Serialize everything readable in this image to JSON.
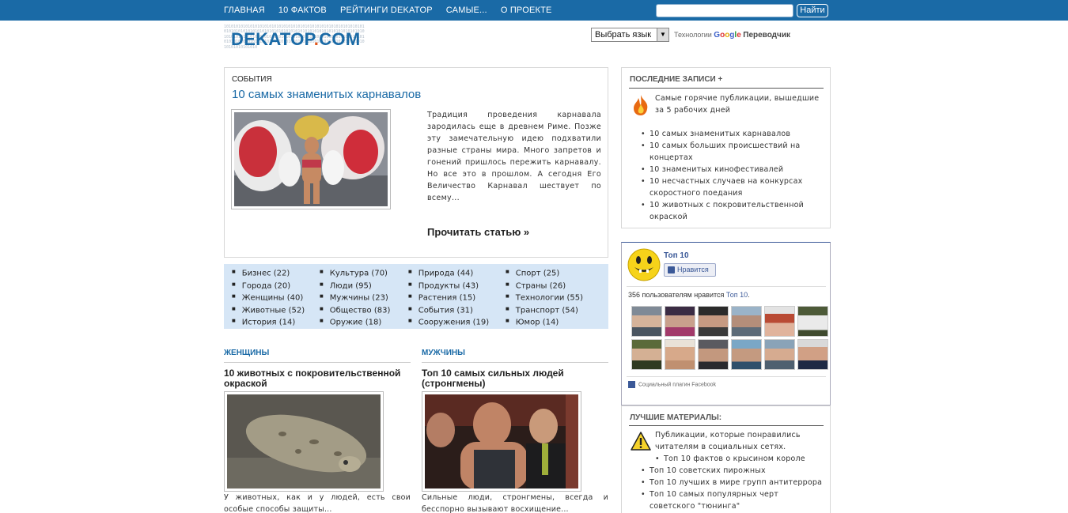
{
  "nav": {
    "items": [
      "ГЛАВНАЯ",
      "10 ФАКТОВ",
      "РЕЙТИНГИ DEKATOP",
      "САМЫЕ...",
      "О ПРОЕКТЕ"
    ],
    "search_placeholder": "",
    "search_button": "Найти"
  },
  "logo": {
    "name": "DEKATOP",
    "dot": ".",
    "tld": "COM",
    "bg_digits": "1010101010101010101010101010101010101010101010101010101010101010101010101010101010101010101010101010101010101010101010101010101010101010101010101010101010101010101010101010101010101010101010101010101010101010101010101010101010101010101010101010101010"
  },
  "translator": {
    "select_label": "Выбрать язык",
    "powered": "Технологии",
    "google": [
      "G",
      "o",
      "o",
      "g",
      "l",
      "e"
    ],
    "product": "Переводчик"
  },
  "featured": {
    "category": "СОБЫТИЯ",
    "title": "10 самых знаменитых карнавалов",
    "text": "Традиция проведения карнавала зародилась еще в древнем Риме. Позже эту замечательную идею подхватили разные страны мира. Много запретов и гонений пришлось пережить карнавалу. Но все это в прошлом. А сегодня Его Величество Карнавал шествует по всему...",
    "read_more": "Прочитать статью »"
  },
  "categories": [
    [
      "Бизнес (22)",
      "Города (20)",
      "Женщины (40)",
      "Животные (52)",
      "История (14)"
    ],
    [
      "Культура (70)",
      "Люди (95)",
      "Мужчины (23)",
      "Общество (83)",
      "Оружие (18)"
    ],
    [
      "Природа (44)",
      "Продукты (43)",
      "Растения (15)",
      "События (31)",
      "Сооружения (19)"
    ],
    [
      "Спорт (25)",
      "Страны (26)",
      "Технологии (55)",
      "Транспорт (54)",
      "Юмор (14)"
    ]
  ],
  "sections": [
    {
      "heading": "ЖЕНЩИНЫ",
      "title": "10 животных с покровительственной окраской",
      "text": "У животных, как и у людей, есть свои особые способы защиты..."
    },
    {
      "heading": "МУЖЧИНЫ",
      "title": "Топ 10 самых сильных людей (стронгмены)",
      "text": "Сильные люди, стронгмены, всегда и бесспорно вызывают восхищение..."
    }
  ],
  "latest": {
    "heading": "ПОСЛЕДНИЕ ЗАПИСИ +",
    "intro": "Самые горячие публикации, вышедшие за 5 рабочих дней",
    "items": [
      "10 самых знаменитых карнавалов",
      "10 самых больших происшествий на концертах",
      "10 знаменитых кинофестивалей",
      "10 несчастных случаев на конкурсах скоростного поедания",
      "10 животных с покровительственной окраской"
    ]
  },
  "facebook": {
    "page_name": "Топ 10",
    "like_label": "Нравится",
    "count_text": "356 пользователям нравится",
    "count_link": "Топ 10",
    "count_end": ".",
    "plugin_label": "Социальный плагин Facebook"
  },
  "best": {
    "heading": "ЛУЧШИЕ МАТЕРИАЛЫ:",
    "intro": "Публикации, которые понравились читателям в социальных сетях.",
    "items": [
      "Топ 10 фактов о крысином короле",
      "Топ 10 советских пирожных",
      "Топ 10 лучших в мире групп антитеррора",
      "Топ 10 самых популярных черт советского \"тюнинга\""
    ]
  },
  "colors": {
    "brand_blue": "#1a6aa6",
    "logo_orange": "#e2561b",
    "category_bg": "#d6e6f6",
    "facebook_blue": "#3b5998"
  }
}
